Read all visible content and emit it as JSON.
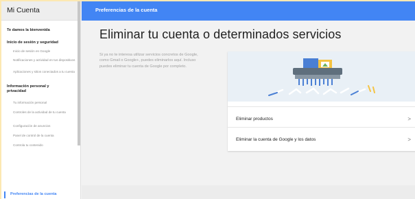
{
  "sidebar": {
    "title": "Mi Cuenta",
    "items": [
      {
        "label": "Te damos la bienvenida",
        "kind": "main"
      },
      {
        "label": "Inicio de sesión y seguridad",
        "kind": "main"
      },
      {
        "label": "Inicio de sesión en Google",
        "kind": "sub"
      },
      {
        "label": "Notificaciones y actividad en tus dispositivos",
        "kind": "sub"
      },
      {
        "label": "Aplicaciones y sitios conectados a tu cuenta",
        "kind": "sub"
      },
      {
        "label": "Información personal y privacidad",
        "kind": "main"
      },
      {
        "label": "Tu información personal",
        "kind": "sub"
      },
      {
        "label": "Controles de la actividad de tu cuenta",
        "kind": "sub"
      },
      {
        "label": "Configuración de anuncios",
        "kind": "sub"
      },
      {
        "label": "Panel de control de la cuenta",
        "kind": "sub"
      },
      {
        "label": "Controla tu contenido",
        "kind": "sub"
      },
      {
        "label": "Preferencias de la cuenta",
        "kind": "active"
      }
    ]
  },
  "header": {
    "title": "Preferencias de la cuenta"
  },
  "main": {
    "title": "Eliminar tu cuenta o determinados servicios",
    "intro": "Si ya no te interesa utilizar servicios concretos de Google, como Gmail o Google+, puedes eliminarlos aquí. Incluso puedes eliminar tu cuenta de Google por completo.",
    "options": [
      {
        "label": "Eliminar productos",
        "chevron": ">"
      },
      {
        "label": "Eliminar la cuenta de Google y los datos",
        "chevron": ">"
      }
    ]
  },
  "colors": {
    "accent": "#4285f4",
    "background": "#f2f2f2"
  },
  "icons": [
    "shredder-illustration",
    "chevron-right-icon"
  ]
}
